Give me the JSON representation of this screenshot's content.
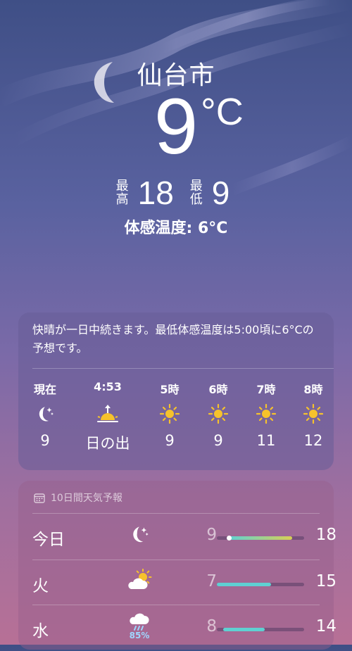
{
  "location": {
    "city": "仙台市"
  },
  "current": {
    "temp": "9",
    "unit": "°C",
    "high_label": "最高",
    "high": "18",
    "low_label": "最低",
    "low": "9",
    "feels_like": "体感温度: 6°C"
  },
  "hourly_card": {
    "summary": "快晴が一日中続きます。最低体感温度は5:00頃に6°Cの予想です。",
    "hours": [
      {
        "time": "現在",
        "icon": "moon-stars-icon",
        "value": "9"
      },
      {
        "time": "4:53",
        "icon": "sunrise-icon",
        "value": "日の出"
      },
      {
        "time": "5時",
        "icon": "sun-icon",
        "value": "9"
      },
      {
        "time": "6時",
        "icon": "sun-icon",
        "value": "9"
      },
      {
        "time": "7時",
        "icon": "sun-icon",
        "value": "11"
      },
      {
        "time": "8時",
        "icon": "sun-icon",
        "value": "12"
      }
    ]
  },
  "forecast_card": {
    "header": "10日間天気予報",
    "header_icon": "calendar-icon",
    "days": [
      {
        "day": "今日",
        "icon": "moon-stars-icon",
        "precip": "",
        "low": "9",
        "high": "18",
        "range_start": 0.14,
        "range_end": 0.86
      },
      {
        "day": "火",
        "icon": "cloud-sun-icon",
        "precip": "",
        "low": "7",
        "high": "15",
        "range_start": 0.0,
        "range_end": 0.62
      },
      {
        "day": "水",
        "icon": "cloud-rain-icon",
        "precip": "85%",
        "low": "8",
        "high": "14",
        "range_start": 0.07,
        "range_end": 0.55
      }
    ]
  },
  "colors": {
    "sun": "#f6c22c",
    "range_cool": "#5fd0d2",
    "range_warm": "#d8cf54",
    "precip": "#9fd6ff"
  }
}
